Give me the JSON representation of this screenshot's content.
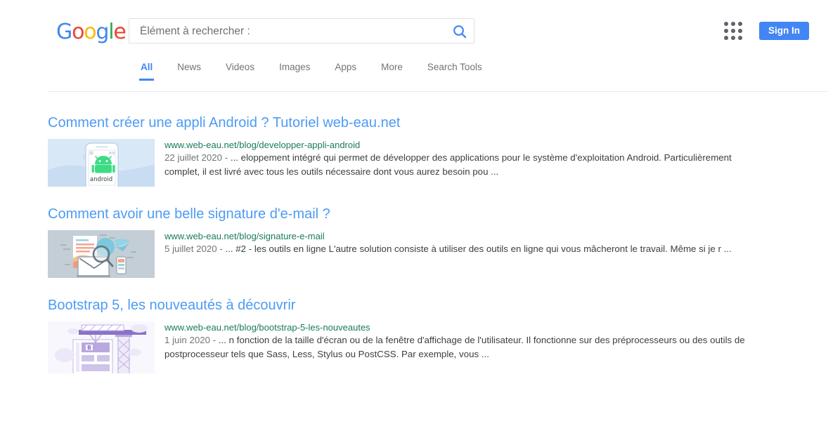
{
  "header": {
    "logo_text": "Google",
    "logo_letters": [
      {
        "ch": "G",
        "color": "#4285F4"
      },
      {
        "ch": "o",
        "color": "#EA4335"
      },
      {
        "ch": "o",
        "color": "#FBBC05"
      },
      {
        "ch": "g",
        "color": "#4285F4"
      },
      {
        "ch": "l",
        "color": "#34A853"
      },
      {
        "ch": "e",
        "color": "#EA4335"
      }
    ],
    "search": {
      "value": "",
      "placeholder": "Élément à rechercher :",
      "search_icon": "search-icon"
    },
    "apps_icon": "apps-grid-icon",
    "signin_label": "Sign In",
    "signin_color": "#4285F4"
  },
  "tabs": [
    {
      "label": "All",
      "active": true
    },
    {
      "label": "News",
      "active": false
    },
    {
      "label": "Videos",
      "active": false
    },
    {
      "label": "Images",
      "active": false
    },
    {
      "label": "Apps",
      "active": false
    },
    {
      "label": "More",
      "active": false
    },
    {
      "label": "Search Tools",
      "active": false
    }
  ],
  "results": [
    {
      "title": "Comment créer une appli Android ? Tutoriel web-eau.net",
      "url": "www.web-eau.net/blog/developper-appli-android",
      "date": "22 juillet 2020 - ",
      "snippet": "... eloppement intégré qui permet de développer des applications pour le système d'exploitation Android. Particulièrement complet, il est livré avec tous les outils nécessaire dont vous aurez besoin pou ...",
      "thumb_name": "android-phone-thumbnail"
    },
    {
      "title": "Comment avoir une belle signature d'e-mail ?",
      "url": "www.web-eau.net/blog/signature-e-mail",
      "date": "5 juillet 2020 - ",
      "snippet": "...  #2 - les outils en ligne L'autre solution consiste à utiliser des outils en ligne qui vous mâcheront le travail. Même si je r ...",
      "thumb_name": "email-signature-thumbnail"
    },
    {
      "title": "Bootstrap 5, les nouveautés à découvrir",
      "url": "www.web-eau.net/blog/bootstrap-5-les-nouveautes",
      "date": "1 juin 2020 - ",
      "snippet": "... n fonction de la taille d'écran ou de la fenêtre d'affichage de l'utilisateur. Il fonctionne sur des préprocesseurs ou des outils de postprocesseur tels que Sass, Less, Stylus ou PostCSS. Par exemple, vous ...",
      "thumb_name": "bootstrap-crane-thumbnail"
    }
  ],
  "colors": {
    "link_blue": "#4d9bf5",
    "accent_blue": "#4285F4",
    "url_green": "#1a7a5e",
    "text_gray": "#70757a"
  }
}
